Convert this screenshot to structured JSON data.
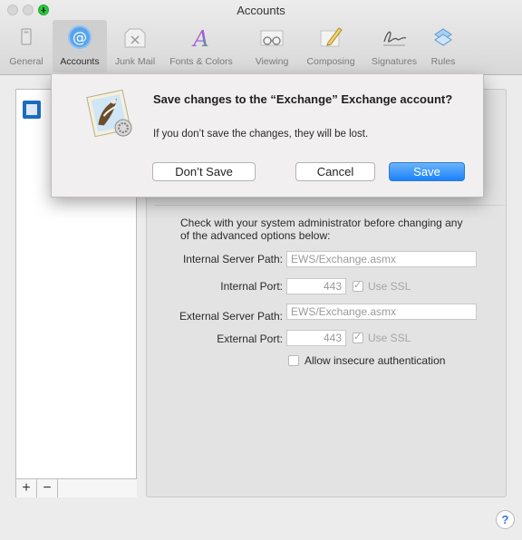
{
  "window": {
    "title": "Accounts"
  },
  "toolbar": {
    "items": [
      {
        "label": "General",
        "icon": "general-icon"
      },
      {
        "label": "Accounts",
        "icon": "at-sign-icon"
      },
      {
        "label": "Junk Mail",
        "icon": "junk-mail-icon"
      },
      {
        "label": "Fonts & Colors",
        "icon": "fonts-colors-icon"
      },
      {
        "label": "Viewing",
        "icon": "glasses-icon"
      },
      {
        "label": "Composing",
        "icon": "pencil-icon"
      },
      {
        "label": "Signatures",
        "icon": "signature-icon"
      },
      {
        "label": "Rules",
        "icon": "rules-icon"
      }
    ],
    "selected": "Accounts"
  },
  "sidebar": {
    "accounts": [
      {
        "icon": "exchange-icon"
      }
    ],
    "add_label": "+",
    "remove_label": "−"
  },
  "dialog": {
    "title": "Save changes to the “Exchange” Exchange account?",
    "message": "If you don’t save the changes, they will be lost.",
    "dont_save_label": "Don’t Save",
    "cancel_label": "Cancel",
    "save_label": "Save",
    "accent": "#1a82fb"
  },
  "advanced": {
    "instruction": "Check with your system administrator before changing any of the advanced options below:",
    "internal_server_path_label": "Internal Server Path:",
    "internal_server_path_value": "EWS/Exchange.asmx",
    "internal_port_label": "Internal Port:",
    "internal_port_value": "443",
    "internal_ssl_label": "Use SSL",
    "external_server_path_label": "External Server Path:",
    "external_server_path_value": "EWS/Exchange.asmx",
    "external_port_label": "External Port:",
    "external_port_value": "443",
    "external_ssl_label": "Use SSL",
    "insecure_auth_label": "Allow insecure authentication"
  },
  "help": {
    "label": "?"
  }
}
